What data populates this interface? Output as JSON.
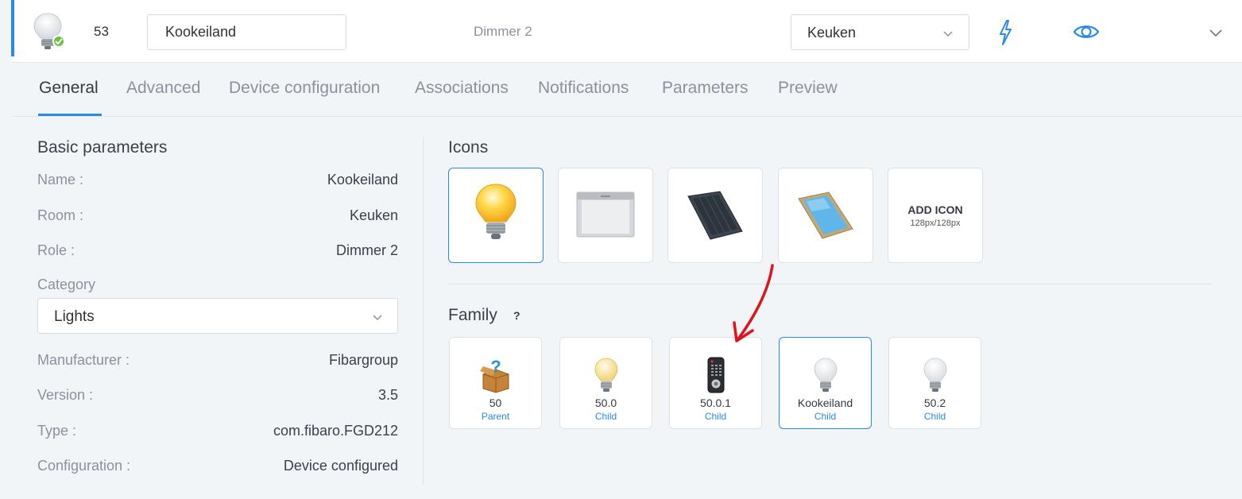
{
  "header": {
    "device_id": "53",
    "name_value": "Kookeiland",
    "role": "Dimmer 2",
    "room_value": "Keuken",
    "status": "ok",
    "accent_color": "#2a8ae6"
  },
  "tabs": [
    {
      "label": "General",
      "active": true
    },
    {
      "label": "Advanced"
    },
    {
      "label": "Device configuration"
    },
    {
      "label": "Associations"
    },
    {
      "label": "Notifications"
    },
    {
      "label": "Parameters"
    },
    {
      "label": "Preview"
    }
  ],
  "basic": {
    "title": "Basic parameters",
    "name_label": "Name :",
    "name_value": "Kookeiland",
    "room_label": "Room :",
    "room_value": "Keuken",
    "role_label": "Role :",
    "role_value": "Dimmer 2",
    "category_label": "Category",
    "category_value": "Lights",
    "manufacturer_label": "Manufacturer :",
    "manufacturer_value": "Fibargroup",
    "version_label": "Version :",
    "version_value": "3.5",
    "type_label": "Type :",
    "type_value": "com.fibaro.FGD212",
    "configuration_label": "Configuration :",
    "configuration_value": "Device configured"
  },
  "icons": {
    "title": "Icons",
    "items": [
      "lightbulb-on-icon",
      "blind-icon",
      "solar-panel-icon",
      "window-icon"
    ],
    "add_title": "ADD ICON",
    "add_sub": "128px/128px"
  },
  "family": {
    "title": "Family",
    "help": "?",
    "items": [
      {
        "label": "50",
        "relation": "Parent",
        "icon": "unknown-box-icon"
      },
      {
        "label": "50.0",
        "relation": "Child",
        "icon": "lightbulb-on-icon"
      },
      {
        "label": "50.0.1",
        "relation": "Child",
        "icon": "remote-control-icon"
      },
      {
        "label": "Kookeiland",
        "relation": "Child",
        "icon": "lightbulb-off-icon",
        "selected": true
      },
      {
        "label": "50.2",
        "relation": "Child",
        "icon": "lightbulb-off-icon"
      }
    ]
  }
}
